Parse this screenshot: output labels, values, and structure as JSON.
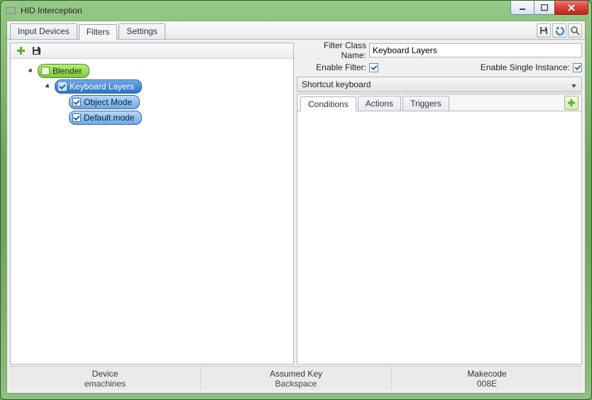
{
  "window": {
    "title": "HID Interception"
  },
  "tabs": {
    "items": [
      {
        "label": "Input Devices",
        "active": false
      },
      {
        "label": "Filters",
        "active": true
      },
      {
        "label": "Settings",
        "active": false
      }
    ]
  },
  "tree": {
    "root": {
      "label": "Blender"
    },
    "filter": {
      "label": "Keyboard Layers"
    },
    "children": [
      {
        "label": "Object Mode"
      },
      {
        "label": "Default mode"
      }
    ]
  },
  "form": {
    "filter_class_label": "Filter Class Name:",
    "filter_class_value": "Keyboard Layers",
    "enable_filter_label": "Enable Filter:",
    "enable_filter_checked": true,
    "enable_single_label": "Enable Single Instance:",
    "enable_single_checked": true,
    "section_title": "Shortcut keyboard"
  },
  "subtabs": {
    "items": [
      {
        "label": "Conditions",
        "active": true
      },
      {
        "label": "Actions",
        "active": false
      },
      {
        "label": "Triggers",
        "active": false
      }
    ]
  },
  "status": {
    "device_hdr": "Device",
    "device_val": "emachines",
    "key_hdr": "Assumed Key",
    "key_val": "Backspace",
    "make_hdr": "Makecode",
    "make_val": "008E"
  }
}
